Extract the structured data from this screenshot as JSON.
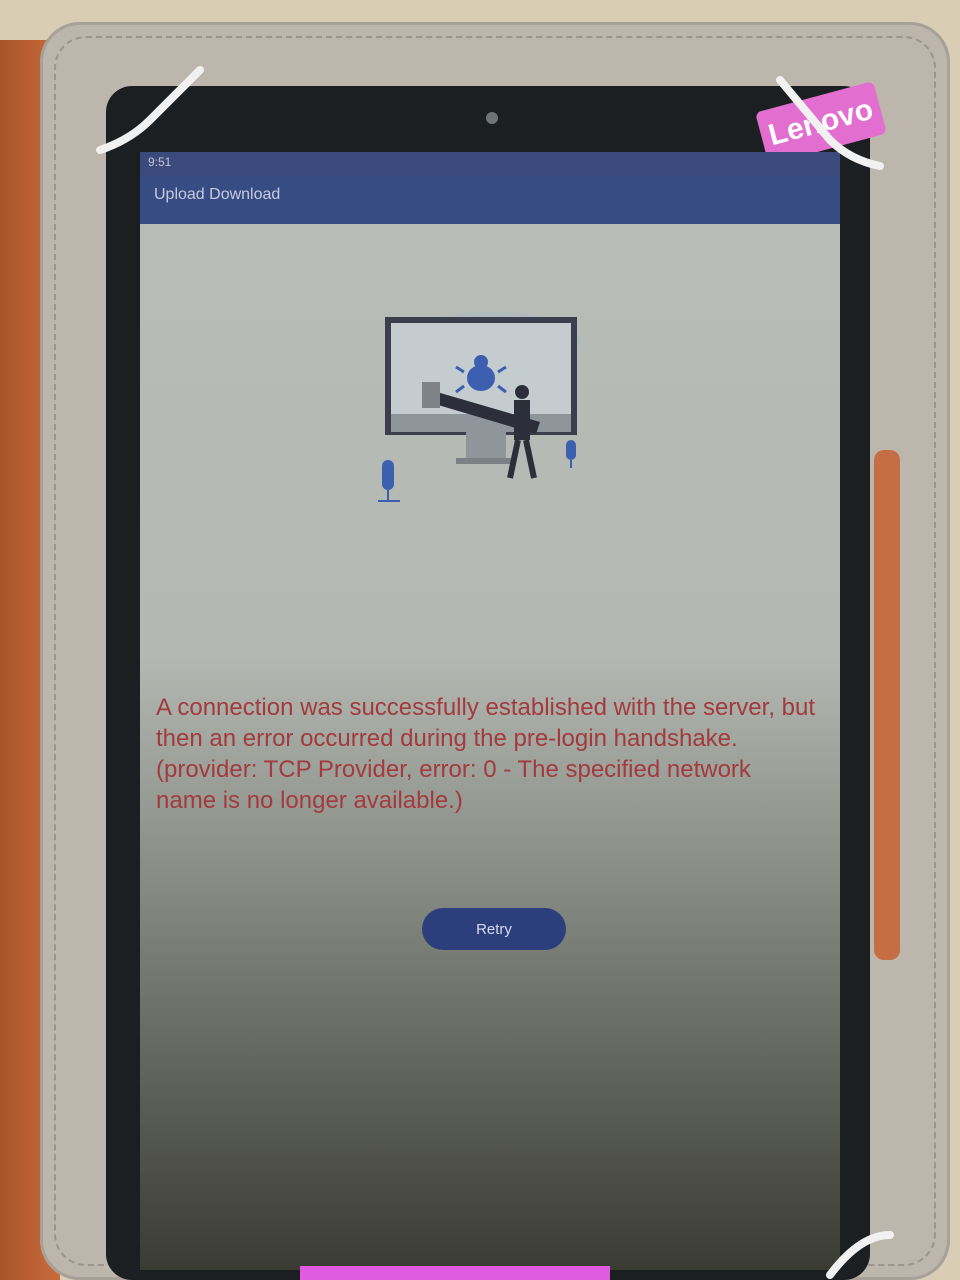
{
  "status_bar": {
    "time": "9:51"
  },
  "app_bar": {
    "title": "Upload Download"
  },
  "device": {
    "brand": "Lenovo"
  },
  "error": {
    "message": "A connection was successfully established with the server, but then an error occurred during the pre-login handshake. (provider: TCP Provider, error: 0 - The specified network name is no longer available.)"
  },
  "actions": {
    "retry_label": "Retry"
  },
  "icons": {
    "illustration": "bug-fixing-illustration-icon",
    "bug": "bug-icon"
  },
  "colors": {
    "app_bar": "#384c84",
    "error_text": "#a33a3d",
    "button": "#2c3f7c"
  }
}
